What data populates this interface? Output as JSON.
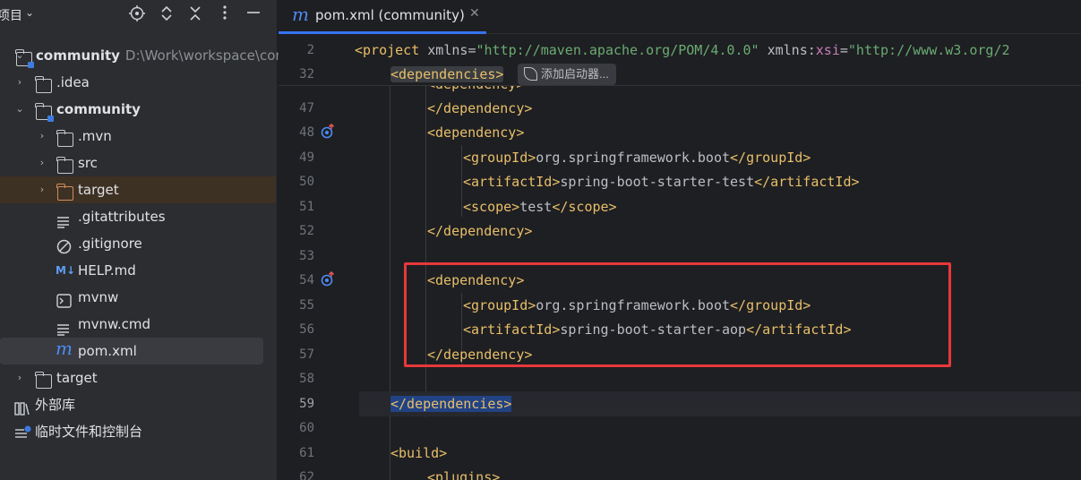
{
  "project_panel": {
    "title": "项目",
    "tree": [
      {
        "label": "community",
        "path": "D:\\Work\\workspace\\com",
        "bold": true
      },
      {
        "label": ".idea"
      },
      {
        "label": "community",
        "bold": true
      },
      {
        "label": ".mvn"
      },
      {
        "label": "src"
      },
      {
        "label": "target"
      },
      {
        "label": ".gitattributes"
      },
      {
        "label": ".gitignore"
      },
      {
        "label": "HELP.md",
        "icon_text": "M↓"
      },
      {
        "label": "mvnw"
      },
      {
        "label": "mvnw.cmd"
      },
      {
        "label": "pom.xml"
      },
      {
        "label": "target"
      },
      {
        "label": "外部库"
      },
      {
        "label": "临时文件和控制台"
      }
    ],
    "header_icons": [
      "locate-icon",
      "expand-collapse-icon",
      "collapse-all-icon",
      "more-vert-icon",
      "hide-icon"
    ]
  },
  "editor": {
    "tab": {
      "label": "pom.xml (community)",
      "icon_text": "m"
    },
    "sticky_lines": [
      {
        "number": "2",
        "text_parts": [
          "<project",
          " xmlns",
          "=",
          "\"http://maven.apache.org/POM/4.0.0\"",
          " xmlns",
          ":",
          "xsi",
          "=",
          "\"http://www.w3.org/2"
        ]
      },
      {
        "number": "32",
        "text": "<dependencies>"
      }
    ],
    "hint": "添加启动器...",
    "partial_top_line": "<dependency>",
    "lines": [
      {
        "number": "47",
        "text": "</dependency>",
        "indent": 2
      },
      {
        "number": "48",
        "text": "<dependency>",
        "indent": 2,
        "marker": true
      },
      {
        "number": "49",
        "open": "<groupId>",
        "content": "org.springframework.boot",
        "close": "</groupId>",
        "indent": 3
      },
      {
        "number": "50",
        "open": "<artifactId>",
        "content": "spring-boot-starter-test",
        "close": "</artifactId>",
        "indent": 3
      },
      {
        "number": "51",
        "open": "<scope>",
        "content": "test",
        "close": "</scope>",
        "indent": 3
      },
      {
        "number": "52",
        "text": "</dependency>",
        "indent": 2
      },
      {
        "number": "53",
        "text": "",
        "indent": 0
      },
      {
        "number": "54",
        "text": "<dependency>",
        "indent": 2,
        "marker": true
      },
      {
        "number": "55",
        "open": "<groupId>",
        "content": "org.springframework.boot",
        "close": "</groupId>",
        "indent": 3
      },
      {
        "number": "56",
        "open": "<artifactId>",
        "content": "spring-boot-starter-aop",
        "close": "</artifactId>",
        "indent": 3
      },
      {
        "number": "57",
        "text": "</dependency>",
        "indent": 2
      },
      {
        "number": "58",
        "text": "",
        "indent": 0
      },
      {
        "number": "59",
        "text": "</dependencies>",
        "indent": 1,
        "current": true
      },
      {
        "number": "60",
        "text": "",
        "indent": 0
      },
      {
        "number": "61",
        "text": "<build>",
        "indent": 1
      },
      {
        "number": "62",
        "text": "<plugins>",
        "indent": 2
      }
    ]
  },
  "colors": {
    "tag": "#e8bf6a",
    "string": "#6aab73",
    "namespace": "#c77dbb",
    "highlight_box": "#e8383a",
    "selection": "#214283",
    "accent": "#3574f0"
  }
}
